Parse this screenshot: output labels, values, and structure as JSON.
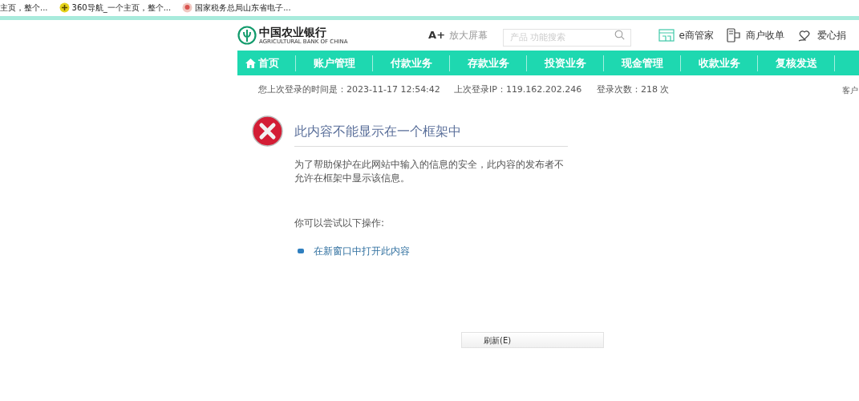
{
  "bookmarks": [
    {
      "kind": "plain",
      "label": "主页，整个..."
    },
    {
      "kind": "plus",
      "label": "360导航_一个主页，整个..."
    },
    {
      "kind": "emblem",
      "label": "国家税务总局山东省电子..."
    }
  ],
  "header": {
    "logo": {
      "name": "中国农业银行",
      "english": "AGRICULTURAL BANK OF CHINA"
    },
    "zoom": {
      "symbol": "A+",
      "label": "放大屏幕"
    },
    "search": {
      "placeholder": "产品 功能搜索"
    },
    "links": [
      {
        "kind": "shop",
        "label": "e商管家"
      },
      {
        "kind": "pos",
        "label": "商户收单"
      },
      {
        "kind": "heart",
        "label": "爱心捐"
      }
    ]
  },
  "nav": [
    {
      "kind": "home",
      "label": "首页"
    },
    {
      "kind": "link",
      "label": "账户管理"
    },
    {
      "kind": "link",
      "label": "付款业务"
    },
    {
      "kind": "link",
      "label": "存款业务"
    },
    {
      "kind": "link",
      "label": "投资业务"
    },
    {
      "kind": "link",
      "label": "现金管理"
    },
    {
      "kind": "link",
      "label": "收款业务"
    },
    {
      "kind": "link",
      "label": "复核发送"
    }
  ],
  "info": [
    "您上次登录的时间是：2023-11-17 12:54:42",
    "上次登录IP：119.162.202.246",
    "登录次数：218 次",
    "客户"
  ],
  "error": {
    "title": "此内容不能显示在一个框架中",
    "message": "为了帮助保护在此网站中输入的信息的安全，此内容的发布者不允许在框架中显示该信息。",
    "hint": "你可以尝试以下操作:",
    "actions": [
      "在新窗口中打开此内容"
    ],
    "button": "刷新(E)"
  }
}
